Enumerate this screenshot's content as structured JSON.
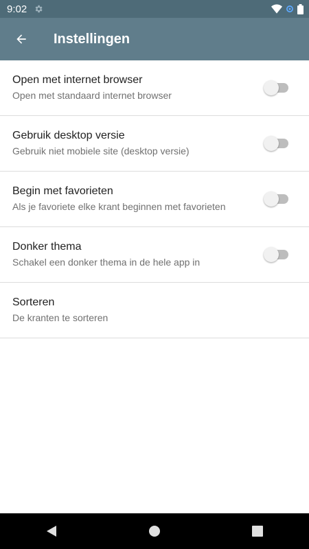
{
  "status_bar": {
    "time": "9:02",
    "icons": [
      "settings-icon",
      "wifi-icon",
      "sync-icon",
      "battery-icon"
    ]
  },
  "app_bar": {
    "title": "Instellingen",
    "back_icon": "arrow-left-icon"
  },
  "settings": [
    {
      "title": "Open met internet browser",
      "subtitle": "Open met standaard internet browser",
      "toggle": false
    },
    {
      "title": "Gebruik desktop versie",
      "subtitle": "Gebruik niet mobiele site (desktop versie)",
      "toggle": false
    },
    {
      "title": "Begin met favorieten",
      "subtitle": "Als je favoriete elke krant beginnen met favorieten",
      "toggle": false
    },
    {
      "title": "Donker thema",
      "subtitle": "Schakel een donker thema in de hele app in",
      "toggle": false
    },
    {
      "title": "Sorteren",
      "subtitle": "De kranten te sorteren"
    }
  ],
  "colors": {
    "status_bar": "#4e6b78",
    "app_bar": "#607d8b",
    "divider": "#dcdcdc",
    "nav_bar": "#000000"
  },
  "nav_bar": {
    "icons": [
      "back-triangle-icon",
      "home-circle-icon",
      "recents-square-icon"
    ]
  }
}
